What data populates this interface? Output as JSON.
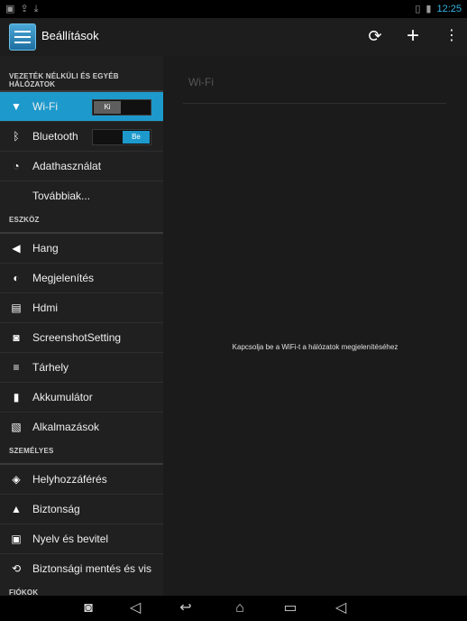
{
  "statusbar": {
    "time": "12:25"
  },
  "actionbar": {
    "title": "Beállítások"
  },
  "sidebar": {
    "sections": [
      {
        "header": "VEZETÉK NÉLKÜLI ÉS EGYÉB HÁLÓZATOK"
      },
      {
        "header": "ESZKÖZ"
      },
      {
        "header": "SZEMÉLYES"
      },
      {
        "header": "FIÓKOK"
      }
    ],
    "items": [
      {
        "label": "Wi-Fi",
        "toggle": "Ki"
      },
      {
        "label": "Bluetooth",
        "toggle": "Be"
      },
      {
        "label": "Adathasználat"
      },
      {
        "label": "Továbbiak..."
      },
      {
        "label": "Hang"
      },
      {
        "label": "Megjelenítés"
      },
      {
        "label": "Hdmi"
      },
      {
        "label": "ScreenshotSetting"
      },
      {
        "label": "Tárhely"
      },
      {
        "label": "Akkumulátor"
      },
      {
        "label": "Alkalmazások"
      },
      {
        "label": "Helyhozzáférés"
      },
      {
        "label": "Biztonság"
      },
      {
        "label": "Nyelv és bevitel"
      },
      {
        "label": "Biztonsági mentés és vis"
      }
    ]
  },
  "detail": {
    "title": "Wi-Fi",
    "message": "Kapcsolja be a WiFi-t a hálózatok megjelenítéséhez"
  },
  "colors": {
    "accent": "#1d99cc",
    "status_time": "#33b5e5"
  }
}
